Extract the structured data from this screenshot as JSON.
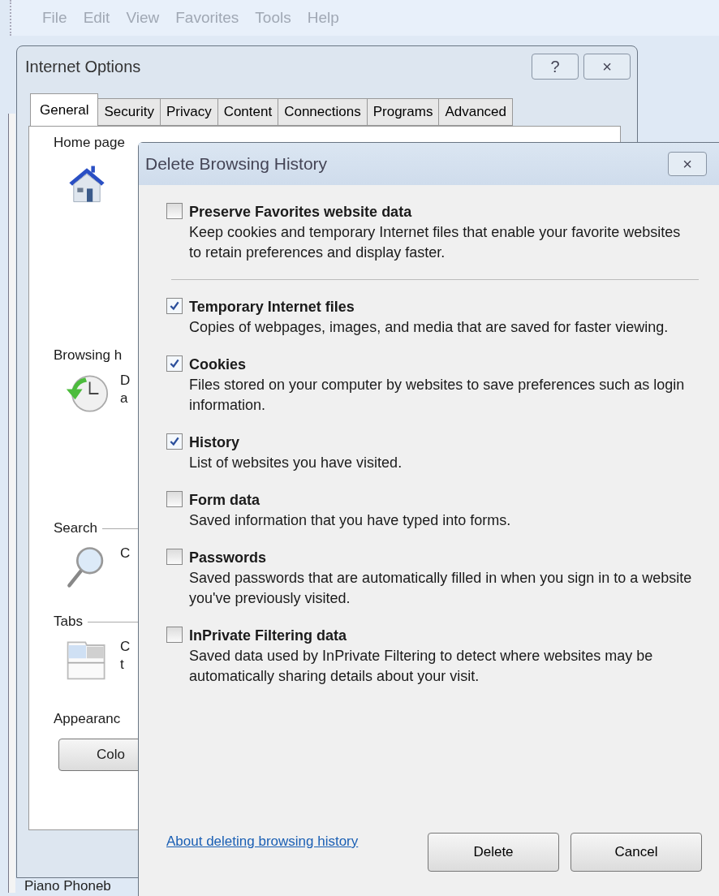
{
  "menu_bar": [
    "File",
    "Edit",
    "View",
    "Favorites",
    "Tools",
    "Help"
  ],
  "internet_options": {
    "title": "Internet Options",
    "title_buttons": [
      "?",
      "×"
    ],
    "tabs": [
      {
        "label": "General",
        "selected": true
      },
      {
        "label": "Security",
        "selected": false
      },
      {
        "label": "Privacy",
        "selected": false
      },
      {
        "label": "Content",
        "selected": false
      },
      {
        "label": "Connections",
        "selected": false
      },
      {
        "label": "Programs",
        "selected": false
      },
      {
        "label": "Advanced",
        "selected": false
      }
    ],
    "home_page": {
      "heading": "Home page"
    },
    "browsing_history": {
      "heading": "Browsing h",
      "text_lines": [
        "D",
        "a"
      ]
    },
    "search": {
      "heading": "Search",
      "text_lines": [
        "C"
      ]
    },
    "tabs_section": {
      "heading": "Tabs",
      "text_lines": [
        "C",
        "t"
      ]
    },
    "appearance": {
      "heading": "Appearanc",
      "button": "Colo"
    },
    "behind_text": "Piano Phoneb"
  },
  "dialog": {
    "title": "Delete Browsing History",
    "close": "×",
    "sections": [
      [
        {
          "label": "Preserve Favorites website data",
          "description": "Keep cookies and temporary Internet files that enable your favorite websites to retain preferences and display faster.",
          "checked": false
        }
      ],
      [
        {
          "label": "Temporary Internet files",
          "description": "Copies of webpages, images, and media that are saved for faster viewing.",
          "checked": true
        },
        {
          "label": "Cookies",
          "description": "Files stored on your computer by websites to save preferences such as login information.",
          "checked": true
        },
        {
          "label": "History",
          "description": "List of websites you have visited.",
          "checked": true
        },
        {
          "label": "Form data",
          "description": "Saved information that you have typed into forms.",
          "checked": false
        },
        {
          "label": "Passwords",
          "description": "Saved passwords that are automatically filled in when you sign in to a website you've previously visited.",
          "checked": false
        },
        {
          "label": "InPrivate Filtering data",
          "description": "Saved data used by InPrivate Filtering to detect where websites may be automatically sharing details about your visit.",
          "checked": false
        }
      ]
    ],
    "link": "About deleting browsing history",
    "buttons": [
      "Delete",
      "Cancel"
    ]
  }
}
